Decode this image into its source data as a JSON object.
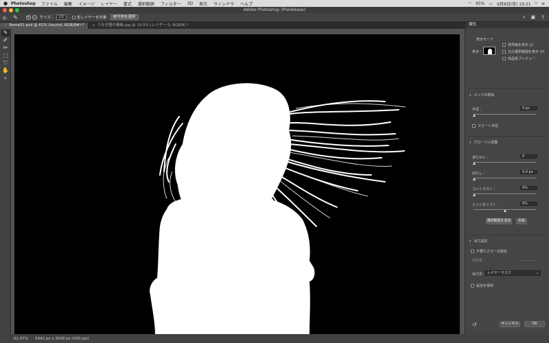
{
  "menubar": {
    "app_name": "Photoshop",
    "items": [
      "ファイル",
      "編集",
      "イメージ",
      "レイヤー",
      "書式",
      "選択範囲",
      "フィルター",
      "3D",
      "表示",
      "ウィンドウ",
      "ヘルプ"
    ],
    "battery": "65%",
    "datetime": "6月8日(月)  19:21"
  },
  "window": {
    "title": "Adobe Photoshop (Prerelease)"
  },
  "options_bar": {
    "size_label": "サイズ :",
    "size_value": "13",
    "all_layers_label": "全レイヤーを対象",
    "select_subject_label": "被写体を選択"
  },
  "tabs": [
    {
      "label": "Rome01.psd @ 61% (tourist, RGB/8#) *",
      "active": true
    },
    {
      "label": "うなぎ屋の看板.jpg @ 19.5% (レイヤー 0, RGB/8) *",
      "active": false
    }
  ],
  "status_bar": {
    "zoom": "61.07%",
    "doc_info": "5442 px x 3628 px (300 ppi)"
  },
  "panel": {
    "title": "属性",
    "view_mode": {
      "heading": "表示モード",
      "view_label": "表示 :",
      "options": [
        "境界線を表示 (J)",
        "元の選択範囲を表示 (P)",
        "高品質プレビュー"
      ]
    },
    "edge_detection": {
      "heading": "エッジの検出",
      "radius_label": "半径 :",
      "radius_value": "0 px",
      "smart_radius_label": "スマート半径"
    },
    "global_refinements": {
      "heading": "グローバル調整",
      "smooth_label": "滑らかに :",
      "smooth_value": "0",
      "feather_label": "ぼかし :",
      "feather_value": "0.0 px",
      "contrast_label": "コントラスト :",
      "contrast_value": "0%",
      "shift_edge_label": "エッジをシフト :",
      "shift_edge_value": "0%",
      "clear_selection_label": "選択範囲を消去",
      "invert_label": "反転"
    },
    "output": {
      "heading": "出力設定",
      "decontaminate_label": "不要なカラーの除去",
      "amount_label": "適用量 :",
      "output_to_label": "出力先 :",
      "output_to_value": "レイヤーマスク",
      "remember_label": "設定を保存"
    },
    "cancel_label": "キャンセル",
    "ok_label": "OK"
  }
}
